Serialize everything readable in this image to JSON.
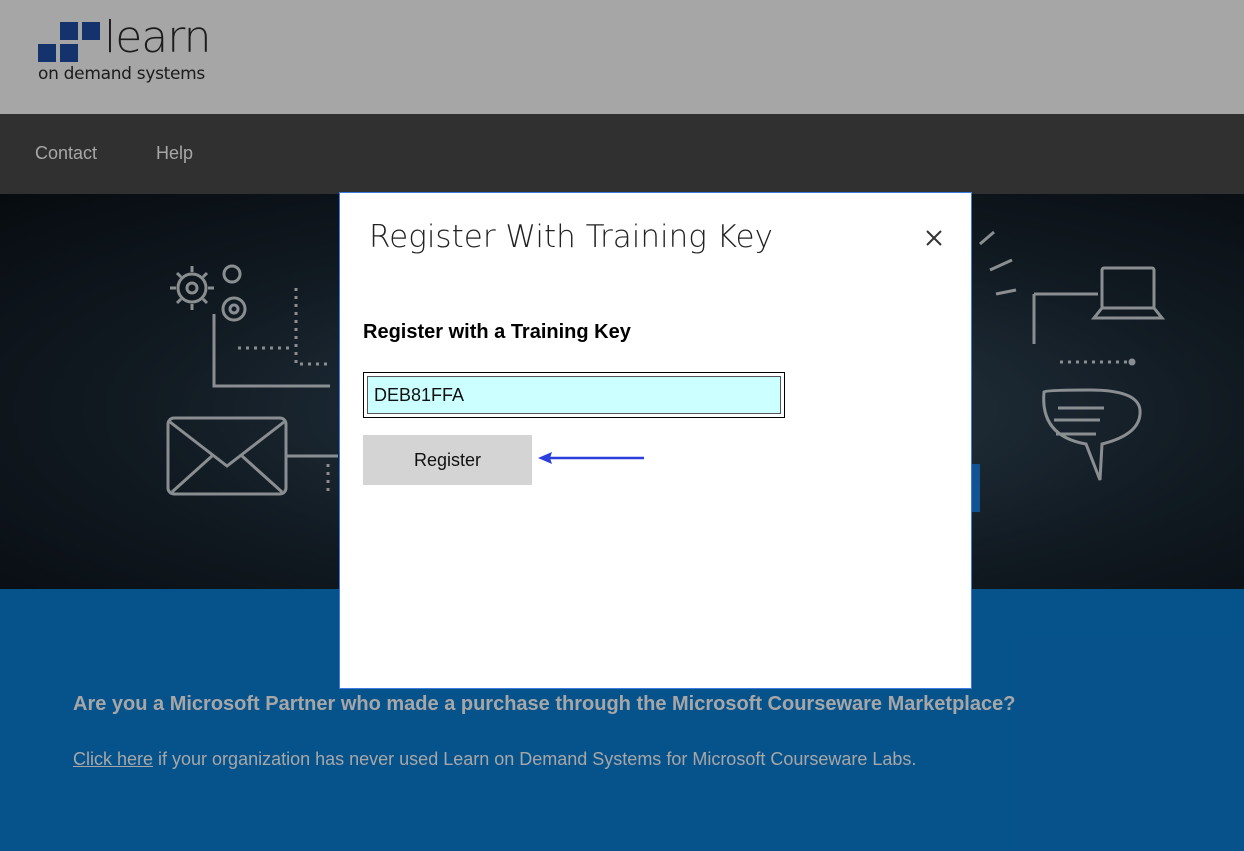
{
  "header": {
    "logo_word": "learn",
    "logo_sub": "on demand systems"
  },
  "nav": {
    "items": [
      {
        "label": "Contact"
      },
      {
        "label": "Help"
      }
    ]
  },
  "band": {
    "question": "Are you a Microsoft Partner who made a purchase through the Microsoft Courseware Marketplace?",
    "link_text": "Click here",
    "line_rest": " if your organization has never used Learn on Demand Systems for Microsoft Courseware Labs."
  },
  "modal": {
    "title": "Register With Training Key",
    "close_icon": "close-icon",
    "subtitle": "Register with a Training Key",
    "key_value": "DEB81FFA",
    "register_label": "Register"
  },
  "colors": {
    "brand_blue": "#1f4fa8",
    "band_blue": "#0a7ed6",
    "input_bg": "#ccffff",
    "arrow": "#2a3fdc"
  }
}
